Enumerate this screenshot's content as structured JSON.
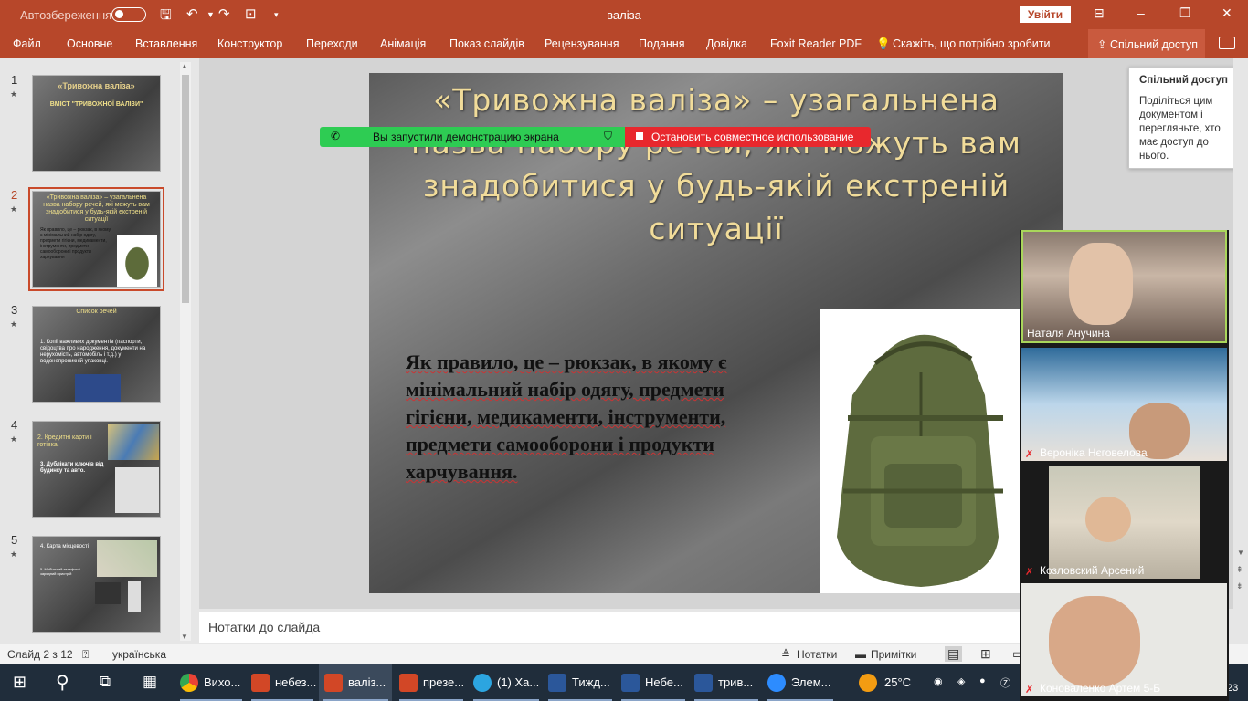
{
  "titlebar": {
    "autosave": "Автозбереження",
    "title": "валіза",
    "signin": "Увійти",
    "minimize": "–",
    "restore": "⧉",
    "maximize": "❐",
    "close": "✕"
  },
  "ribbon": {
    "tabs": [
      "Файл",
      "Основне",
      "Вставлення",
      "Конструктор",
      "Переходи",
      "Анімація",
      "Показ слайдів",
      "Рецензування",
      "Подання",
      "Довідка",
      "Foxit Reader PDF",
      "Скажіть, що потрібно зробити"
    ],
    "share": "Спільний доступ"
  },
  "thumbs": [
    {
      "num": "1",
      "title": "«Тривожна валіза»",
      "sub": "ВМІСТ \"ТРИВОЖНОЇ ВАЛІЗИ\""
    },
    {
      "num": "2",
      "title": "«Тривожна валіза» – узагальнена назва набору речей, які можуть вам знадобитися у будь-якій екстреній ситуації",
      "sub": "Як правило, це – рюкзак, в якому є мінімальний набір одягу, предмети гігієни, медикаменти, інструменти, предмети самооборони і продукти харчування"
    },
    {
      "num": "3",
      "title": "Список речей",
      "sub": "1. Копії важливих документів (паспорти, свідоцтва про народження, документи на нерухомість, автомобіль і т.д.) у водонепроникній упаковці."
    },
    {
      "num": "4",
      "title": "2. Кредитні карти і готівка.",
      "sub": "3. Дублікати ключів від будинку та авто."
    },
    {
      "num": "5",
      "title": "4. Карта місцевості",
      "sub": "5. Мобільний телефон і зарядний пристрій"
    }
  ],
  "slide": {
    "title": "«Тривожна валіза» – узагальнена назва набору речей, які можуть вам знадобитися у будь-якій екстреній ситуації",
    "body": "Як правило, це – рюкзак, в якому є мінімальний набір одягу, предмети гігієни, медикаменти, інструменти, предмети самооборони і продукти харчування."
  },
  "banner": {
    "left": "Вы запустили демонстрацию экрана",
    "right": "Остановить совместное использование"
  },
  "tooltip": {
    "heading": "Спільний доступ",
    "body": "Поділіться цим документом і перегляньте, хто має доступ до нього."
  },
  "notes": {
    "placeholder": "Нотатки до слайда"
  },
  "status": {
    "slide": "Слайд 2 з 12",
    "lang": "українська",
    "notes": "Нотатки",
    "comments": "Примітки"
  },
  "participants": [
    "Наталя Анучина",
    "Вероніка Нєговелова",
    "Козловский Арсений",
    "Коноваленко Артем 5-Б"
  ],
  "taskbar": {
    "items": [
      {
        "label": "Вихо...",
        "color": "#e8a900"
      },
      {
        "label": "небез...",
        "color": "#d24726"
      },
      {
        "label": "валіз...",
        "color": "#d24726"
      },
      {
        "label": "презе...",
        "color": "#d24726"
      },
      {
        "label": "(1) Ха...",
        "color": "#2ca5e0"
      },
      {
        "label": "Тижд...",
        "color": "#2b579a"
      },
      {
        "label": "Небе...",
        "color": "#2b579a"
      },
      {
        "label": "трив...",
        "color": "#2b579a"
      },
      {
        "label": "Элем...",
        "color": "#2d8cff"
      }
    ],
    "weather": "25°C",
    "clock": "23"
  }
}
